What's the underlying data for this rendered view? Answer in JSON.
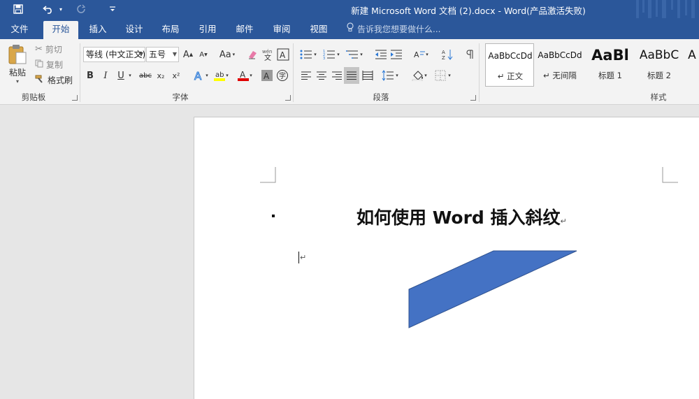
{
  "window": {
    "title": "新建 Microsoft Word 文档 (2).docx - Word(产品激活失败)",
    "quick_access": {
      "save_icon": "save-icon",
      "undo_icon": "undo-icon",
      "redo_icon": "redo-icon",
      "customize_icon": "customize-quick-access-icon"
    }
  },
  "tabs": [
    "文件",
    "开始",
    "插入",
    "设计",
    "布局",
    "引用",
    "邮件",
    "审阅",
    "视图"
  ],
  "active_tab": "开始",
  "tell_me": "告诉我您想要做什么...",
  "ribbon": {
    "clipboard": {
      "label": "剪贴板",
      "paste": "粘贴",
      "cut": "剪切",
      "copy": "复制",
      "format_painter": "格式刷"
    },
    "font": {
      "label": "字体",
      "font_name": "等线 (中文正文)",
      "font_size": "五号",
      "grow": "A",
      "shrink": "A",
      "change_case": "Aa",
      "bold": "B",
      "italic": "I",
      "underline": "U",
      "strikethrough": "abc",
      "subscript": "x₂",
      "superscript": "x²",
      "highlight_color": "#ffff00",
      "font_color": "#e00000"
    },
    "paragraph": {
      "label": "段落"
    },
    "styles": {
      "label": "样式",
      "items": [
        {
          "preview": "AaBbCcDd",
          "name": "↵ 正文"
        },
        {
          "preview": "AaBbCcDd",
          "name": "↵ 无间隔"
        },
        {
          "preview": "AaBl",
          "name": "标题 1"
        },
        {
          "preview": "AaBbC",
          "name": "标题 2"
        },
        {
          "preview": "A",
          "name": ""
        }
      ]
    }
  },
  "document": {
    "heading": "如何使用 Word 插入斜纹",
    "paragraph_mark": "↵",
    "shape_color": "#4472c4",
    "shape_border": "#2f528f"
  },
  "colors": {
    "title_bar": "#2b579a",
    "ribbon_bg": "#f3f3f3",
    "canvas_bg": "#e6e6e6"
  }
}
